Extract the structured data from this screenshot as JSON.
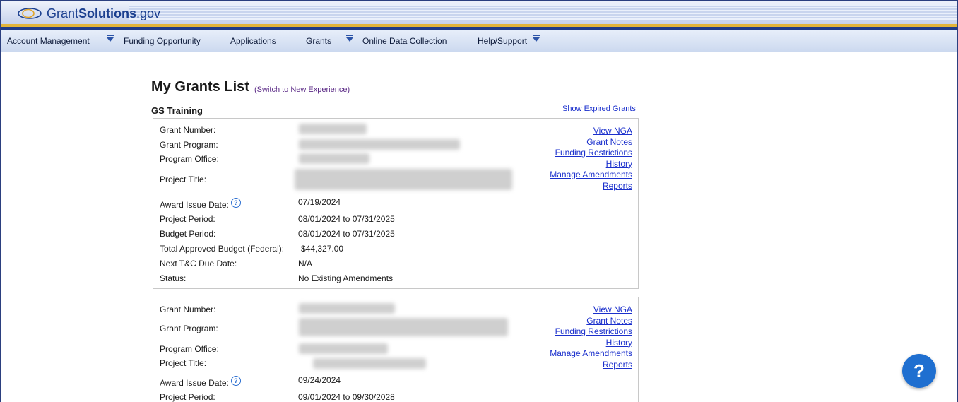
{
  "app": {
    "logo_prefix": "Grant",
    "logo_bold": "Solutions",
    "logo_suffix": ".gov"
  },
  "nav": {
    "items": [
      {
        "label": "Account Management",
        "has_caret": true
      },
      {
        "label": "Funding Opportunity",
        "has_caret": false
      },
      {
        "label": "Applications",
        "has_caret": false
      },
      {
        "label": "Grants",
        "has_caret": true
      },
      {
        "label": "Online Data Collection",
        "has_caret": false
      },
      {
        "label": "Help/Support",
        "has_caret": true
      }
    ]
  },
  "page": {
    "title": "My Grants List",
    "switch_link": "(Switch to New Experience)",
    "section_title": "GS Training",
    "show_expired_link": "Show Expired Grants"
  },
  "grants": [
    {
      "labels": {
        "grant_number": "Grant Number:",
        "grant_program": "Grant Program:",
        "program_office": "Program Office:",
        "project_title": "Project Title:",
        "award_issue_date": "Award Issue Date:",
        "project_period": "Project Period:",
        "budget_period": "Budget Period:",
        "total_budget": "Total Approved Budget (Federal):",
        "next_tc_due": "Next T&C Due Date:",
        "status": "Status:"
      },
      "values": {
        "award_issue_date": "07/19/2024",
        "project_period": "08/01/2024 to 07/31/2025",
        "budget_period": "08/01/2024 to 07/31/2025",
        "total_budget": "$44,327.00",
        "next_tc_due": "N/A",
        "status": "No Existing Amendments"
      },
      "links": [
        "View NGA",
        "Grant Notes",
        "Funding Restrictions",
        "History",
        "Manage Amendments",
        "Reports"
      ]
    },
    {
      "labels": {
        "grant_number": "Grant Number:",
        "grant_program": "Grant Program:",
        "program_office": "Program Office:",
        "project_title": "Project Title:",
        "award_issue_date": "Award Issue Date:",
        "project_period": "Project Period:"
      },
      "values": {
        "award_issue_date": "09/24/2024",
        "project_period": "09/01/2024 to 09/30/2028"
      },
      "links": [
        "View NGA",
        "Grant Notes",
        "Funding Restrictions",
        "History",
        "Manage Amendments",
        "Reports"
      ]
    }
  ],
  "help_button": {
    "label": "?"
  }
}
